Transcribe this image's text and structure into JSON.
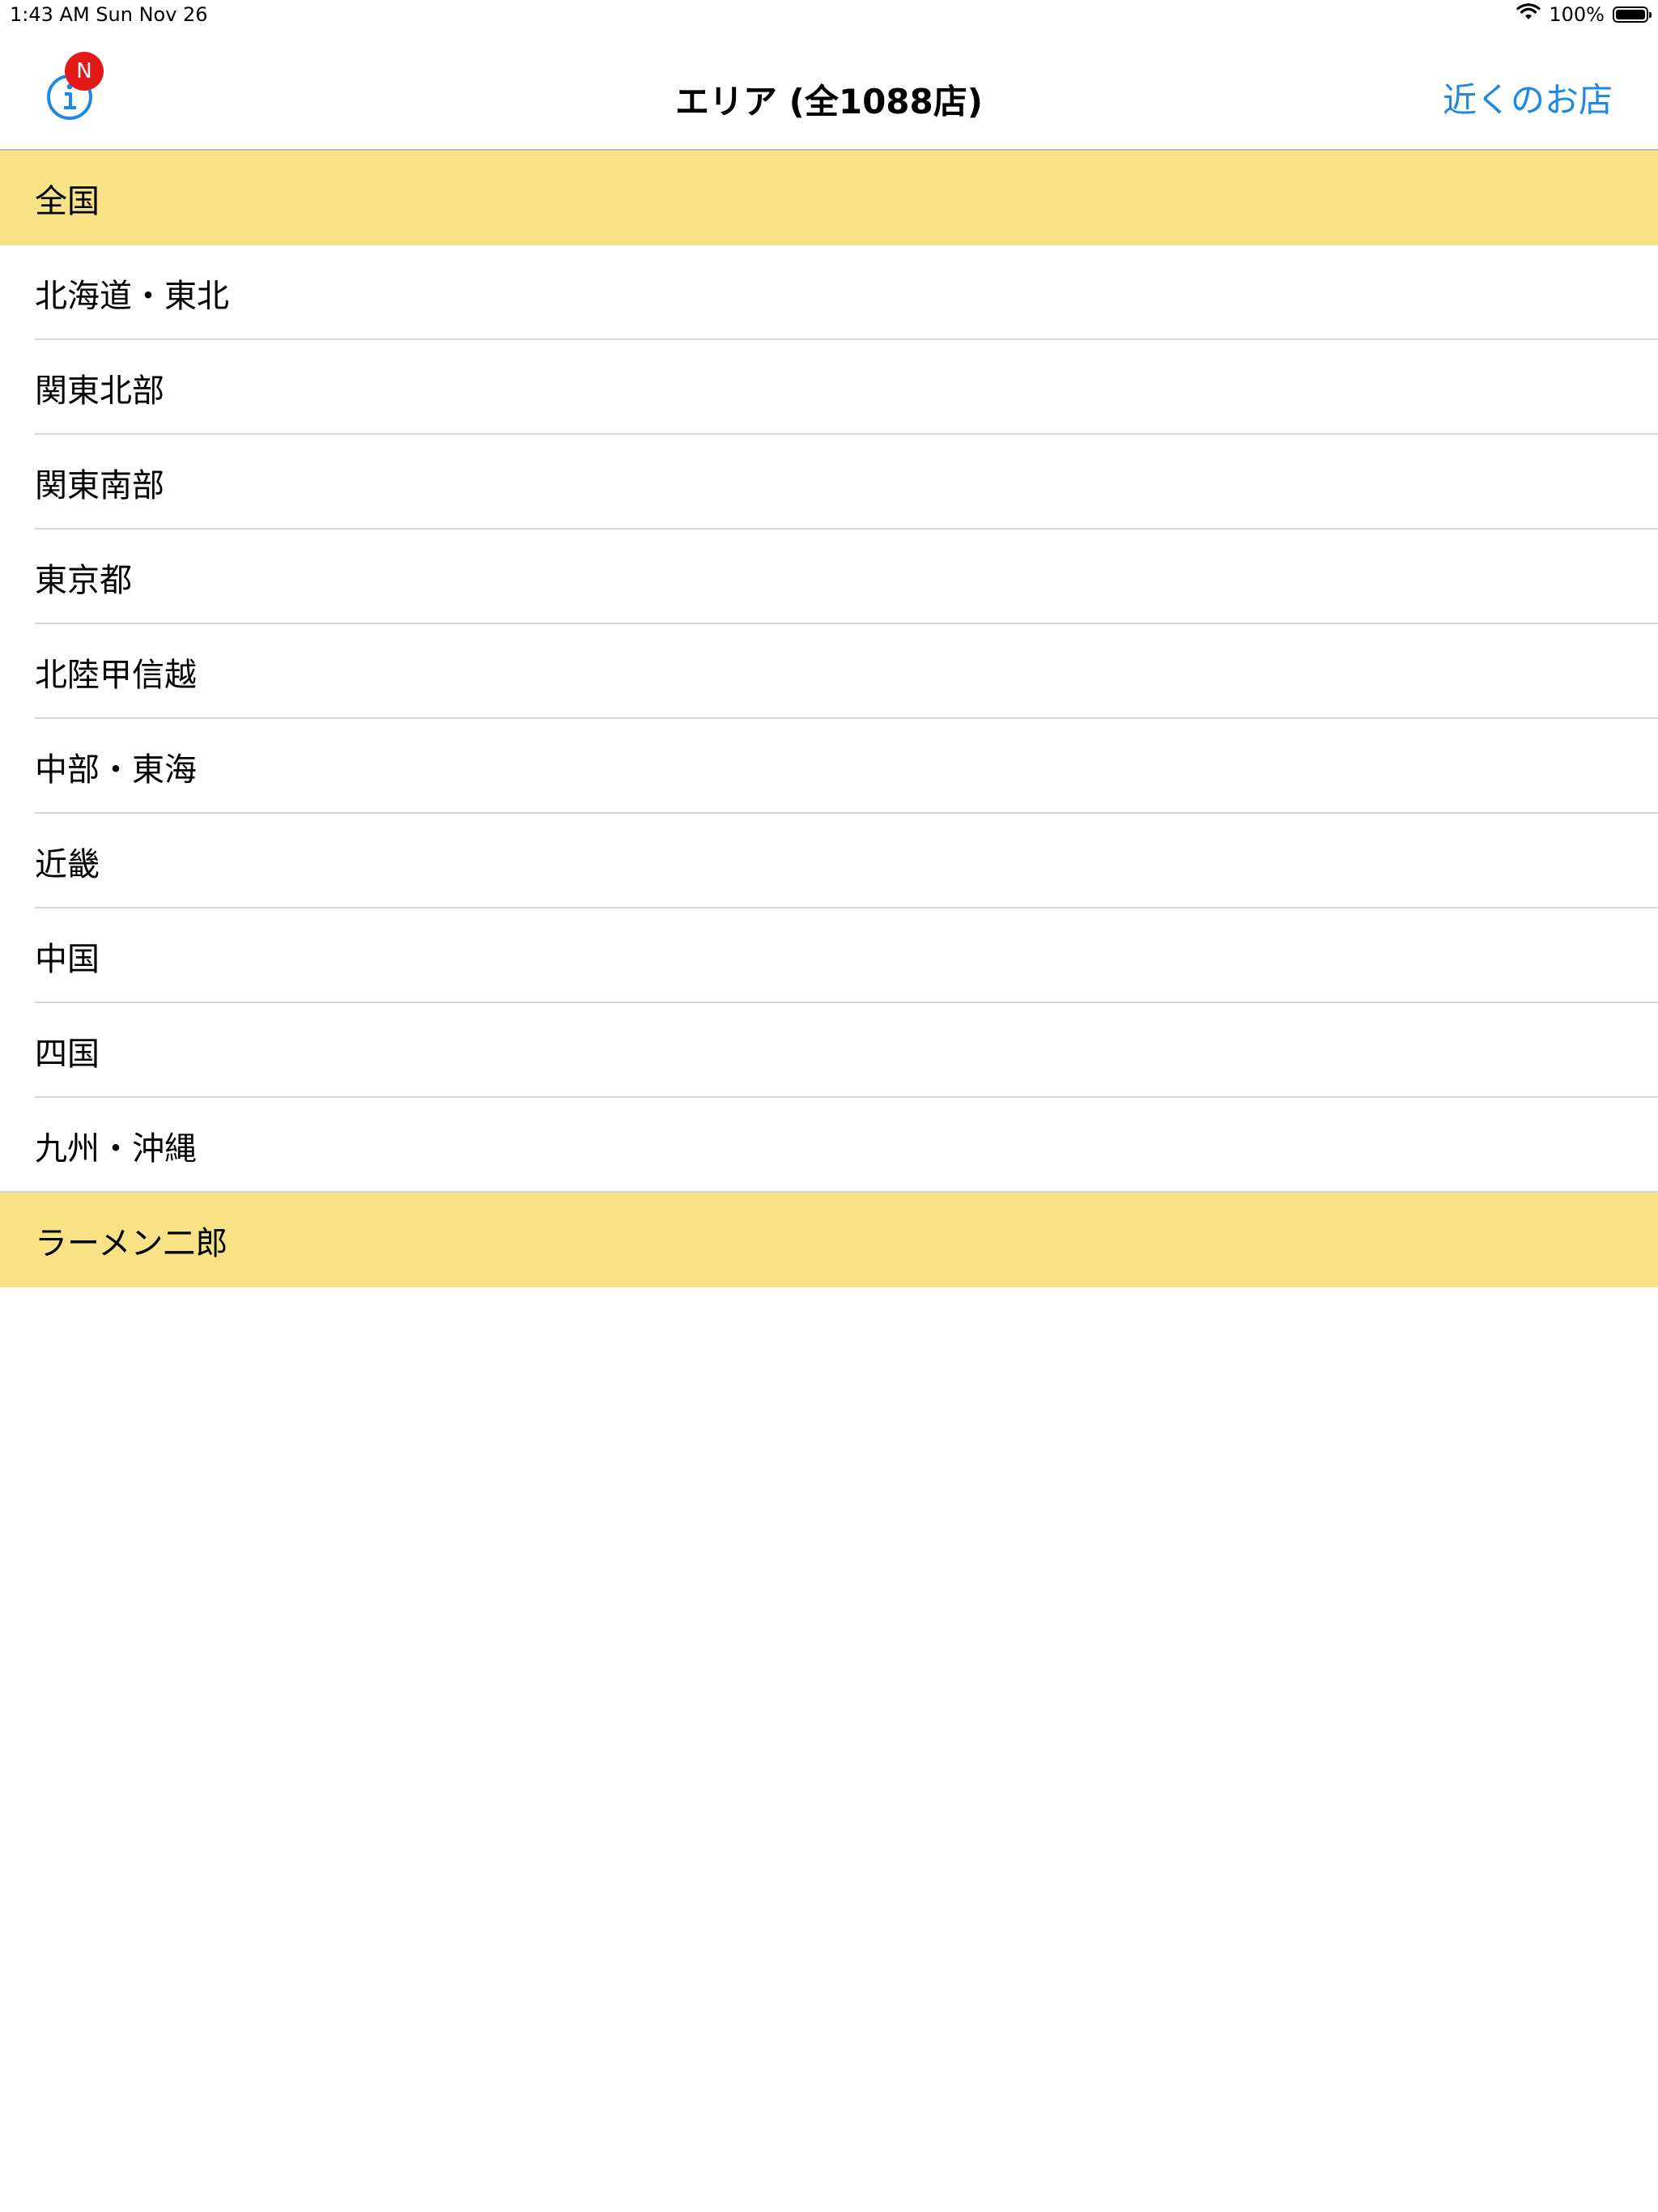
{
  "status_bar": {
    "time_date": "1:43 AM   Sun Nov 26",
    "battery_percent": "100%",
    "wifi_icon": "wifi-icon",
    "battery_icon": "battery-icon"
  },
  "nav": {
    "title": "エリア (全1088店)",
    "info_icon": "info-circle-icon",
    "badge_label": "N",
    "nearby_label": "近くのお店"
  },
  "colors": {
    "accent": "#1e88e5",
    "section_bg": "#f7e285",
    "badge_bg": "#e61919"
  },
  "list": {
    "section_all": "全国",
    "regions": [
      "北海道・東北",
      "関東北部",
      "関東南部",
      "東京都",
      "北陸甲信越",
      "中部・東海",
      "近畿",
      "中国",
      "四国",
      "九州・沖縄"
    ],
    "section_jiro": "ラーメン二郎"
  }
}
